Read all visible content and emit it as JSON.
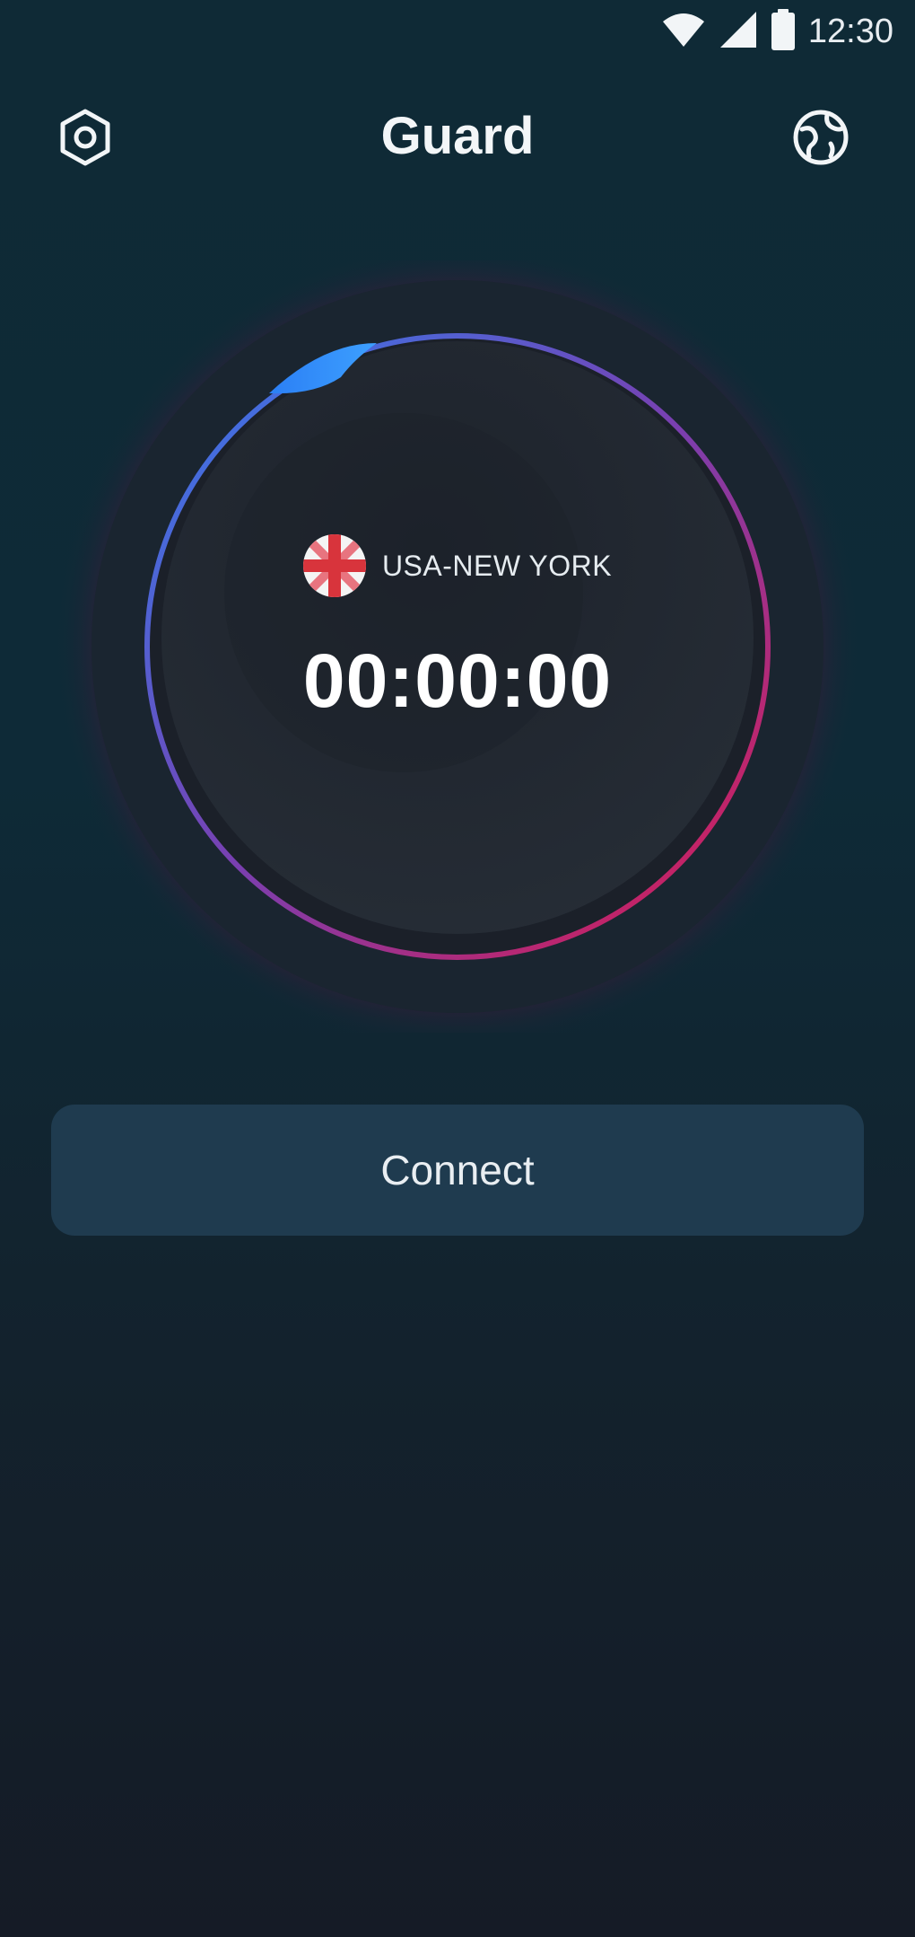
{
  "status_bar": {
    "time": "12:30",
    "icons": [
      "wifi-icon",
      "cellular-signal-icon",
      "battery-icon"
    ]
  },
  "header": {
    "title": "Guard",
    "left_icon": "settings-icon",
    "right_icon": "globe-icon"
  },
  "dial": {
    "location": "USA-NEW YORK",
    "flag_icon": "uk-flag-icon",
    "timer": "00:00:00",
    "ring_colors": [
      "#2f7ff0",
      "#7a3fb0",
      "#e0184a"
    ]
  },
  "connect_button": {
    "label": "Connect"
  },
  "colors": {
    "background_top": "#0f2a36",
    "background_bottom": "#151b26",
    "button": "#1f3b4f",
    "dial_inner": "#1f2630"
  }
}
